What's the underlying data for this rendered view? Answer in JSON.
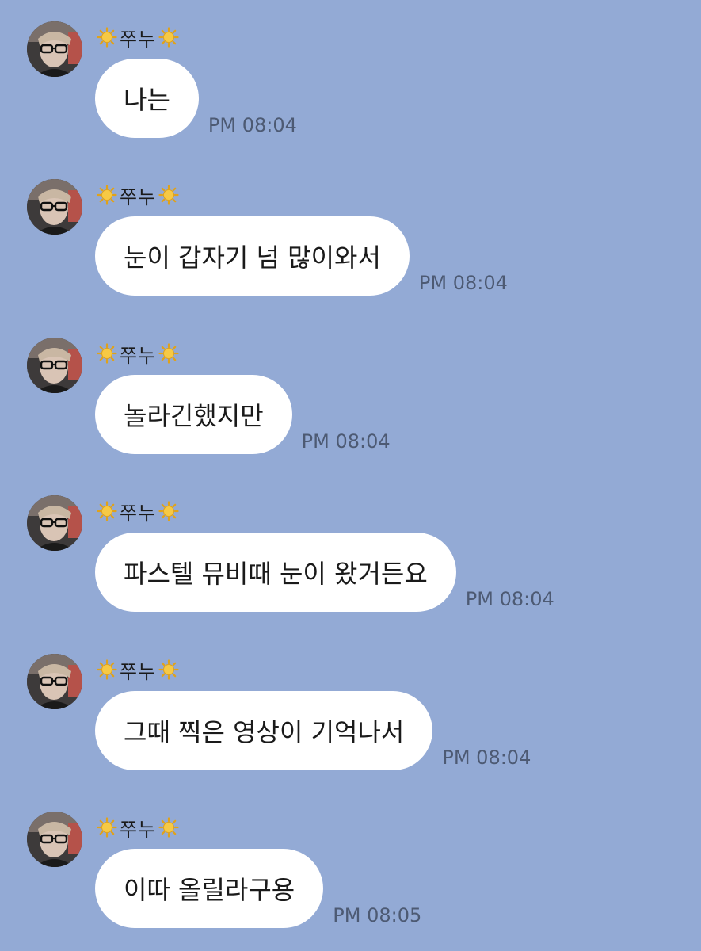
{
  "colors": {
    "background": "#93aad5",
    "bubble": "#ffffff",
    "timestamp": "#4d5a73"
  },
  "messages": [
    {
      "sender": "쭈누",
      "sender_icon": "sun-emoji-icon",
      "text": "나는",
      "time": "PM 08:04"
    },
    {
      "sender": "쭈누",
      "sender_icon": "sun-emoji-icon",
      "text": "눈이 갑자기 넘 많이와서",
      "time": "PM 08:04"
    },
    {
      "sender": "쭈누",
      "sender_icon": "sun-emoji-icon",
      "text": "놀라긴했지만",
      "time": "PM 08:04"
    },
    {
      "sender": "쭈누",
      "sender_icon": "sun-emoji-icon",
      "text": "파스텔 뮤비때 눈이 왔거든요",
      "time": "PM 08:04"
    },
    {
      "sender": "쭈누",
      "sender_icon": "sun-emoji-icon",
      "text": "그때 찍은 영상이 기억나서",
      "time": "PM 08:04"
    },
    {
      "sender": "쭈누",
      "sender_icon": "sun-emoji-icon",
      "text": "이따 올릴라구용",
      "time": "PM 08:05"
    }
  ]
}
